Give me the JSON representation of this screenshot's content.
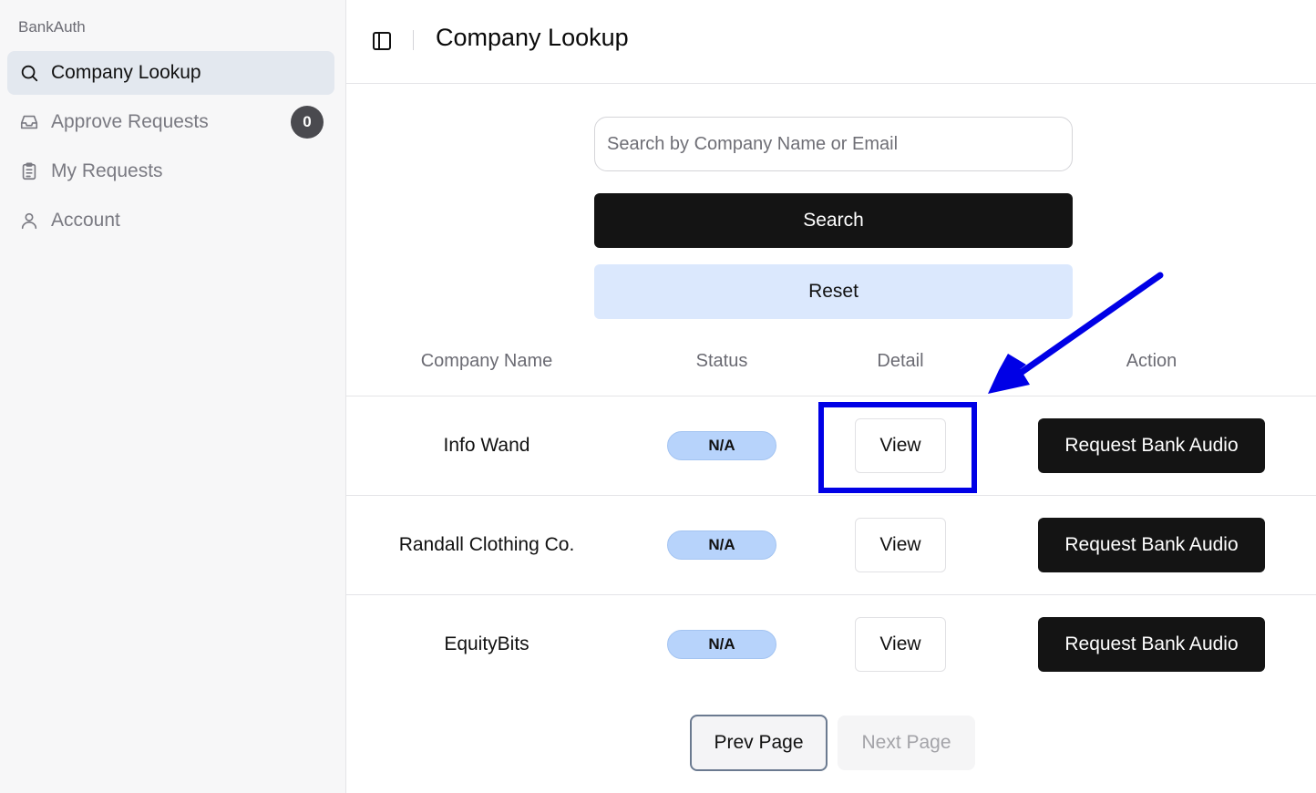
{
  "sidebar": {
    "brand": "BankAuth",
    "items": [
      {
        "label": "Company Lookup",
        "icon": "search-icon",
        "active": true
      },
      {
        "label": "Approve Requests",
        "icon": "inbox-icon",
        "badge": "0"
      },
      {
        "label": "My Requests",
        "icon": "clipboard-icon"
      },
      {
        "label": "Account",
        "icon": "user-icon"
      }
    ]
  },
  "header": {
    "title": "Company Lookup",
    "toggle_icon": "sidebar-toggle-icon"
  },
  "search": {
    "placeholder": "Search by Company Name or Email",
    "value": "",
    "search_label": "Search",
    "reset_label": "Reset"
  },
  "table": {
    "columns": [
      "Company Name",
      "Status",
      "Detail",
      "Action"
    ],
    "rows": [
      {
        "company": "Info Wand",
        "status": "N/A",
        "detail": "View",
        "action": "Request Bank Audio"
      },
      {
        "company": "Randall Clothing Co.",
        "status": "N/A",
        "detail": "View",
        "action": "Request Bank Audio"
      },
      {
        "company": "EquityBits",
        "status": "N/A",
        "detail": "View",
        "action": "Request Bank Audio"
      }
    ]
  },
  "pagination": {
    "prev_label": "Prev Page",
    "next_label": "Next Page"
  },
  "annotation": {
    "color": "#0000e6",
    "icon": "arrow-icon"
  },
  "colors": {
    "primary_button": "#141414",
    "reset_button": "#dbe8fd",
    "status_badge": "#b7d3fb",
    "active_nav": "#e3e8ef"
  }
}
